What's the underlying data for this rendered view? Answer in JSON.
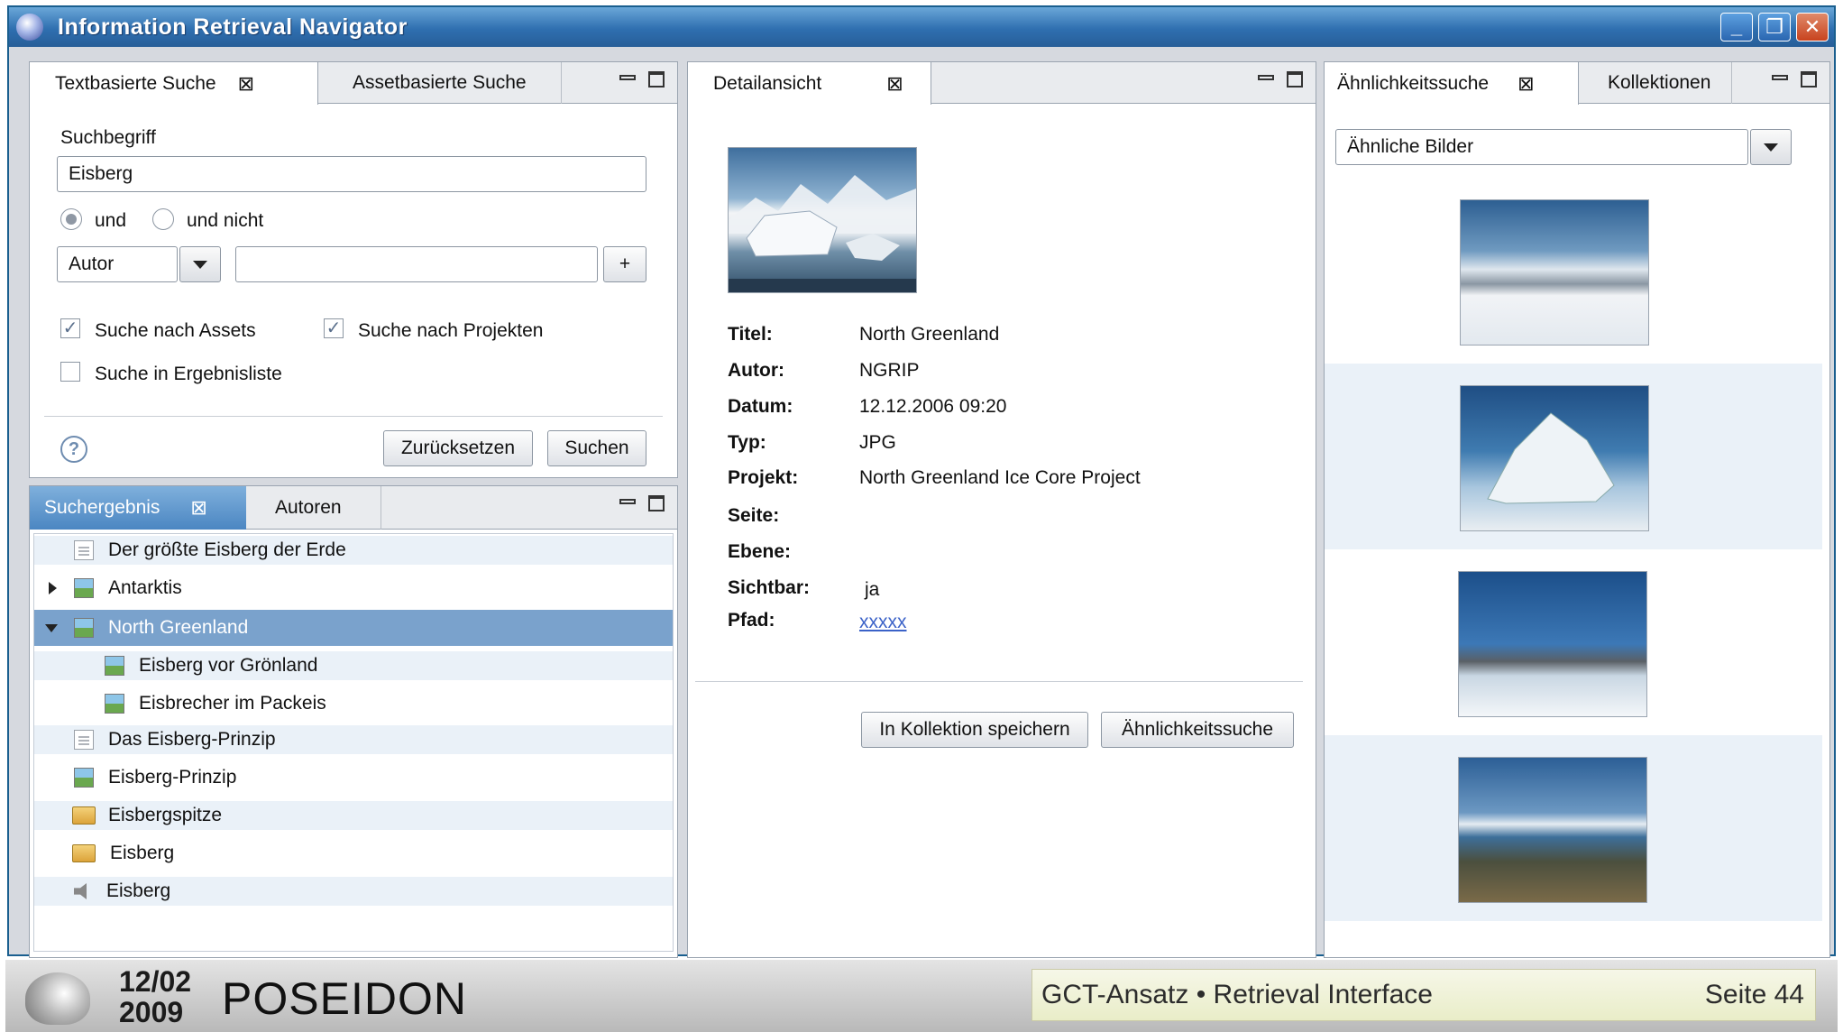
{
  "window": {
    "title": "Information Retrieval Navigator"
  },
  "search_panel": {
    "tabs": [
      "Textbasierte Suche",
      "Assetbasierte Suche"
    ],
    "term_label": "Suchbegriff",
    "term_value": "Eisberg",
    "radio_and": "und",
    "radio_and_not": "und nicht",
    "field_select": "Autor",
    "field_value": "",
    "add_button": "+",
    "check_assets": "Suche nach Assets",
    "check_projects": "Suche nach Projekten",
    "check_results": "Suche in Ergebnisliste",
    "reset_button": "Zurücksetzen",
    "search_button": "Suchen",
    "help_icon": "?"
  },
  "results_panel": {
    "tabs": [
      "Suchergebnis",
      "Autoren"
    ],
    "items": [
      {
        "label": "Der größte Eisberg der Erde",
        "icon": "document-icon",
        "level": 0
      },
      {
        "label": "Antarktis",
        "icon": "image-icon",
        "level": 0,
        "twisty": "collapsed"
      },
      {
        "label": "North Greenland",
        "icon": "image-icon",
        "level": 0,
        "twisty": "expanded",
        "selected": true
      },
      {
        "label": "Eisberg vor Grönland",
        "icon": "image-icon",
        "level": 1
      },
      {
        "label": "Eisbrecher im Packeis",
        "icon": "image-icon",
        "level": 1
      },
      {
        "label": "Das Eisberg-Prinzip",
        "icon": "document-icon",
        "level": 0
      },
      {
        "label": "Eisberg-Prinzip",
        "icon": "image-icon",
        "level": 0
      },
      {
        "label": "Eisbergspitze",
        "icon": "project-folder-icon",
        "level": 0
      },
      {
        "label": "Eisberg",
        "icon": "project-folder-icon",
        "level": 0
      },
      {
        "label": "Eisberg",
        "icon": "audio-icon",
        "level": 0
      }
    ]
  },
  "detail_panel": {
    "tab": "Detailansicht",
    "fields": [
      {
        "key": "Titel:",
        "value": "North Greenland"
      },
      {
        "key": "Autor:",
        "value": "NGRIP"
      },
      {
        "key": "Datum:",
        "value": "12.12.2006 09:20"
      },
      {
        "key": "Typ:",
        "value": "JPG"
      },
      {
        "key": "Projekt:",
        "value": "North Greenland Ice Core Project"
      },
      {
        "key": "Seite:",
        "value": ""
      },
      {
        "key": "Ebene:",
        "value": ""
      },
      {
        "key": "Sichtbar:",
        "value": "ja"
      },
      {
        "key": "Pfad:",
        "value": "xxxxx"
      }
    ],
    "save_button": "In Kollektion speichern",
    "similarity_button": "Ähnlichkeitssuche"
  },
  "similarity_panel": {
    "tabs": [
      "Ähnlichkeitssuche",
      "Kollektionen"
    ],
    "select_value": "Ähnliche Bilder"
  },
  "footer": {
    "date_line1": "12/02",
    "date_line2": "2009",
    "brand": "POSEIDON",
    "subtitle": "GCT-Ansatz • Retrieval Interface",
    "page": "Seite 44"
  }
}
